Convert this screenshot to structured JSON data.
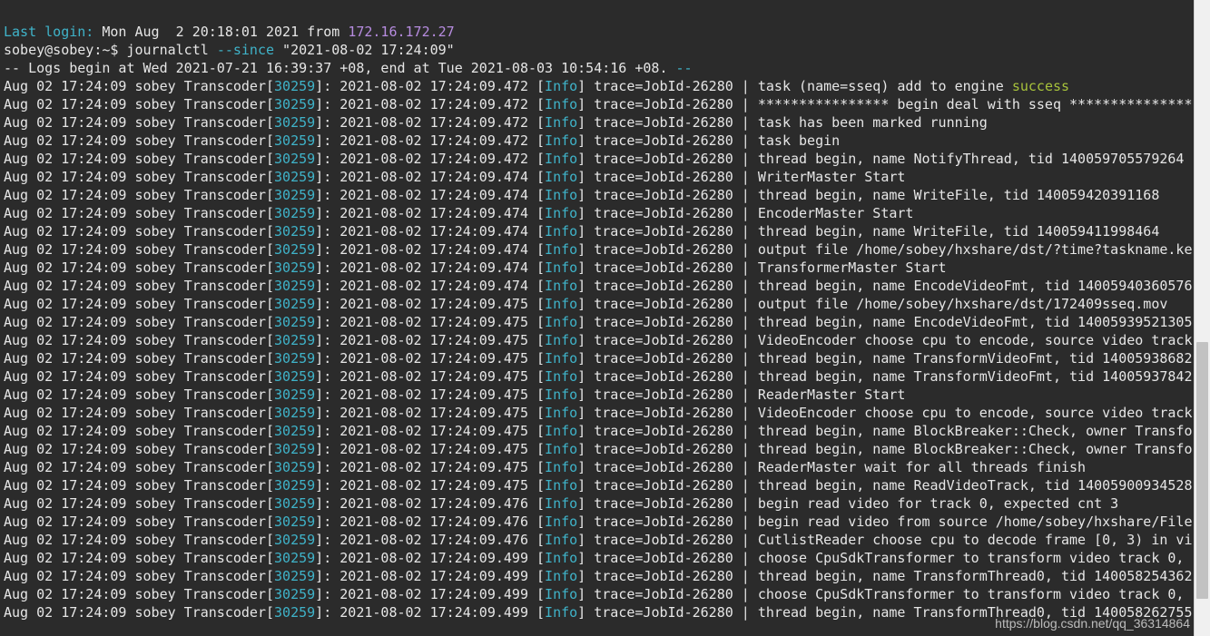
{
  "colors": {
    "background": "#2b2b2b",
    "text": "#e6e6e6",
    "cyan": "#3fb3c9",
    "purple": "#b78ce0",
    "green": "#a7c23b"
  },
  "header": {
    "login_label": "Last login:",
    "login_date": " Mon Aug  2 20:18:01 2021 from ",
    "login_ip": "172.16.172.27",
    "prompt": "sobey@sobey:~$ journalctl ",
    "command_flag": "--since",
    "command_arg": " \"2021-08-02 17:24:09\"",
    "logs_begin": "-- Logs begin at Wed 2021-07-21 16:39:37 +08, end at Tue 2021-08-03 10:54:16 +08. ",
    "logs_begin_tail": "--"
  },
  "log": {
    "prefix": "Aug 02 17:24:09 sobey Transcoder",
    "pid_open": "[",
    "pid": "30259",
    "pid_close": "]: ",
    "level_open": "[",
    "level": "Info",
    "level_close": "] ",
    "trace": "trace=JobId-26280 | ",
    "entries": [
      {
        "ts": "2021-08-02 17:24:09.472 ",
        "msg": "task (name=sseq) add to engine ",
        "msg_tail": "success"
      },
      {
        "ts": "2021-08-02 17:24:09.472 ",
        "msg": "**************** begin deal with sseq ***************",
        "msg_tail": ""
      },
      {
        "ts": "2021-08-02 17:24:09.472 ",
        "msg": "task has been marked running",
        "msg_tail": ""
      },
      {
        "ts": "2021-08-02 17:24:09.472 ",
        "msg": "task begin",
        "msg_tail": ""
      },
      {
        "ts": "2021-08-02 17:24:09.472 ",
        "msg": "thread begin, name NotifyThread, tid 140059705579264",
        "msg_tail": ""
      },
      {
        "ts": "2021-08-02 17:24:09.474 ",
        "msg": "WriterMaster Start",
        "msg_tail": ""
      },
      {
        "ts": "2021-08-02 17:24:09.474 ",
        "msg": "thread begin, name WriteFile, tid 140059420391168",
        "msg_tail": ""
      },
      {
        "ts": "2021-08-02 17:24:09.474 ",
        "msg": "EncoderMaster Start",
        "msg_tail": ""
      },
      {
        "ts": "2021-08-02 17:24:09.474 ",
        "msg": "thread begin, name WriteFile, tid 140059411998464",
        "msg_tail": ""
      },
      {
        "ts": "2021-08-02 17:24:09.474 ",
        "msg": "output file /home/sobey/hxshare/dst/?time?taskname.ke",
        "msg_tail": ""
      },
      {
        "ts": "2021-08-02 17:24:09.474 ",
        "msg": "TransformerMaster Start",
        "msg_tail": ""
      },
      {
        "ts": "2021-08-02 17:24:09.474 ",
        "msg": "thread begin, name EncodeVideoFmt, tid 14005940360576",
        "msg_tail": ""
      },
      {
        "ts": "2021-08-02 17:24:09.475 ",
        "msg": "output file /home/sobey/hxshare/dst/172409sseq.mov",
        "msg_tail": ""
      },
      {
        "ts": "2021-08-02 17:24:09.475 ",
        "msg": "thread begin, name EncodeVideoFmt, tid 14005939521305",
        "msg_tail": ""
      },
      {
        "ts": "2021-08-02 17:24:09.475 ",
        "msg": "VideoEncoder choose cpu to encode, source video track",
        "msg_tail": ""
      },
      {
        "ts": "2021-08-02 17:24:09.475 ",
        "msg": "thread begin, name TransformVideoFmt, tid 14005938682",
        "msg_tail": ""
      },
      {
        "ts": "2021-08-02 17:24:09.475 ",
        "msg": "thread begin, name TransformVideoFmt, tid 14005937842",
        "msg_tail": ""
      },
      {
        "ts": "2021-08-02 17:24:09.475 ",
        "msg": "ReaderMaster Start",
        "msg_tail": ""
      },
      {
        "ts": "2021-08-02 17:24:09.475 ",
        "msg": "VideoEncoder choose cpu to encode, source video track",
        "msg_tail": ""
      },
      {
        "ts": "2021-08-02 17:24:09.475 ",
        "msg": "thread begin, name BlockBreaker::Check, owner Transfo",
        "msg_tail": ""
      },
      {
        "ts": "2021-08-02 17:24:09.475 ",
        "msg": "thread begin, name BlockBreaker::Check, owner Transfo",
        "msg_tail": ""
      },
      {
        "ts": "2021-08-02 17:24:09.475 ",
        "msg": "ReaderMaster wait for all threads finish",
        "msg_tail": ""
      },
      {
        "ts": "2021-08-02 17:24:09.475 ",
        "msg": "thread begin, name ReadVideoTrack, tid 14005900934528",
        "msg_tail": ""
      },
      {
        "ts": "2021-08-02 17:24:09.476 ",
        "msg": "begin read video for track 0, expected cnt 3",
        "msg_tail": ""
      },
      {
        "ts": "2021-08-02 17:24:09.476 ",
        "msg": "begin read video from source /home/sobey/hxshare/File",
        "msg_tail": ""
      },
      {
        "ts": "2021-08-02 17:24:09.476 ",
        "msg": "CutlistReader choose cpu to decode frame [0, 3) in vi",
        "msg_tail": ""
      },
      {
        "ts": "2021-08-02 17:24:09.499 ",
        "msg": "choose CpuSdkTransformer to transform video track 0,",
        "msg_tail": ""
      },
      {
        "ts": "2021-08-02 17:24:09.499 ",
        "msg": "thread begin, name TransformThread0, tid 140058254362",
        "msg_tail": ""
      },
      {
        "ts": "2021-08-02 17:24:09.499 ",
        "msg": "choose CpuSdkTransformer to transform video track 0,",
        "msg_tail": ""
      },
      {
        "ts": "2021-08-02 17:24:09.499 ",
        "msg": "thread begin, name TransformThread0, tid 140058262755",
        "msg_tail": ""
      }
    ]
  },
  "watermark": "https://blog.csdn.net/qq_36314864"
}
